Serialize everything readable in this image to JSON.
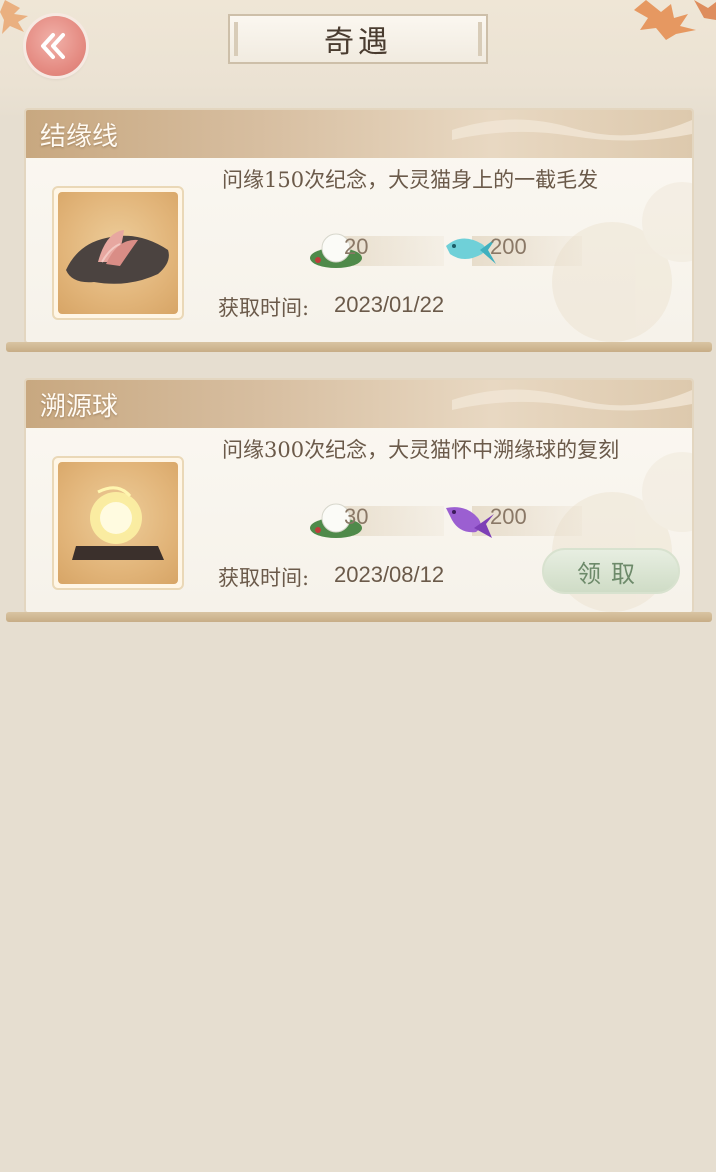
{
  "header": {
    "title": "奇遇"
  },
  "cards": [
    {
      "title": "结缘线",
      "description": "问缘150次纪念，大灵猫身上的一截毛发",
      "rewards": [
        {
          "icon": "rice-ball-icon",
          "value": "20"
        },
        {
          "icon": "blue-fish-icon",
          "value": "200"
        }
      ],
      "time_label": "获取时间:",
      "time_value": "2023/01/22"
    },
    {
      "title": "溯源球",
      "description": "问缘300次纪念，大灵猫怀中溯缘球的复刻",
      "rewards": [
        {
          "icon": "rice-ball-icon",
          "value": "30"
        },
        {
          "icon": "purple-fish-icon",
          "value": "200"
        }
      ],
      "time_label": "获取时间:",
      "time_value": "2023/08/12",
      "claim_label": "领取"
    }
  ],
  "colors": {
    "accent_back": "#e58c83",
    "header_tan": "#c8a880",
    "claim_green": "#6d8a6a"
  }
}
